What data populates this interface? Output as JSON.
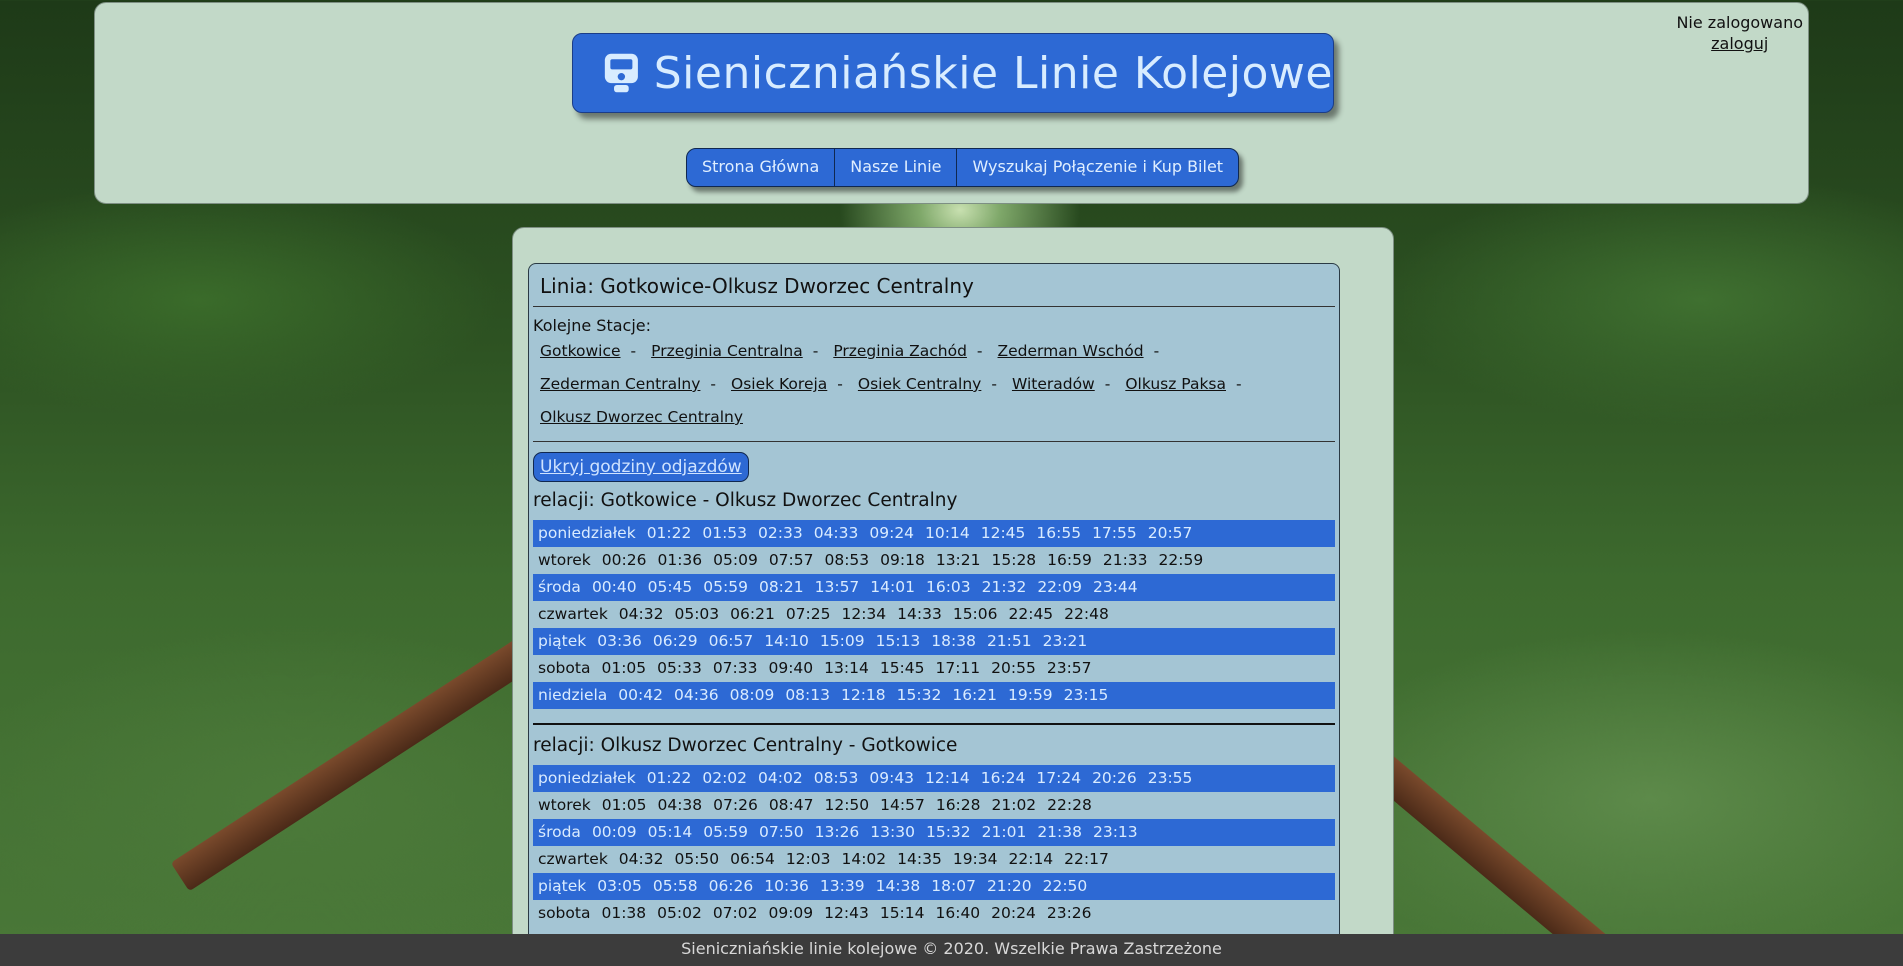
{
  "header": {
    "title": "Sieniczniańskie Linie Kolejowe",
    "logo_icon": "train-icon",
    "login_status": "Nie zalogowano",
    "login_link": "zaloguj",
    "nav": [
      "Strona Główna",
      "Nasze Linie",
      "Wyszukaj Połączenie i Kup Bilet"
    ]
  },
  "line": {
    "title": "Linia: Gotkowice-Olkusz Dworzec Centralny",
    "stations_label": "Kolejne Stacje:",
    "stations": [
      "Gotkowice",
      "Przeginia Centralna",
      "Przeginia Zachód",
      "Zederman Wschód",
      "Zederman Centralny",
      "Osiek Koreja",
      "Osiek Centralny",
      "Witeradów",
      "Olkusz Paksa",
      "Olkusz Dworzec Centralny"
    ],
    "toggle_label": "Ukryj godziny odjazdów",
    "relations": [
      {
        "title": "relacji: Gotkowice - Olkusz Dworzec Centralny",
        "days": [
          {
            "day": "poniedziałek",
            "times": [
              "01:22",
              "01:53",
              "02:33",
              "04:33",
              "09:24",
              "10:14",
              "12:45",
              "16:55",
              "17:55",
              "20:57"
            ]
          },
          {
            "day": "wtorek",
            "times": [
              "00:26",
              "01:36",
              "05:09",
              "07:57",
              "08:53",
              "09:18",
              "13:21",
              "15:28",
              "16:59",
              "21:33",
              "22:59"
            ]
          },
          {
            "day": "środa",
            "times": [
              "00:40",
              "05:45",
              "05:59",
              "08:21",
              "13:57",
              "14:01",
              "16:03",
              "21:32",
              "22:09",
              "23:44"
            ]
          },
          {
            "day": "czwartek",
            "times": [
              "04:32",
              "05:03",
              "06:21",
              "07:25",
              "12:34",
              "14:33",
              "15:06",
              "22:45",
              "22:48"
            ]
          },
          {
            "day": "piątek",
            "times": [
              "03:36",
              "06:29",
              "06:57",
              "14:10",
              "15:09",
              "15:13",
              "18:38",
              "21:51",
              "23:21"
            ]
          },
          {
            "day": "sobota",
            "times": [
              "01:05",
              "05:33",
              "07:33",
              "09:40",
              "13:14",
              "15:45",
              "17:11",
              "20:55",
              "23:57"
            ]
          },
          {
            "day": "niedziela",
            "times": [
              "00:42",
              "04:36",
              "08:09",
              "08:13",
              "12:18",
              "15:32",
              "16:21",
              "19:59",
              "23:15"
            ]
          }
        ]
      },
      {
        "title": "relacji: Olkusz Dworzec Centralny - Gotkowice",
        "days": [
          {
            "day": "poniedziałek",
            "times": [
              "01:22",
              "02:02",
              "04:02",
              "08:53",
              "09:43",
              "12:14",
              "16:24",
              "17:24",
              "20:26",
              "23:55"
            ]
          },
          {
            "day": "wtorek",
            "times": [
              "01:05",
              "04:38",
              "07:26",
              "08:47",
              "12:50",
              "14:57",
              "16:28",
              "21:02",
              "22:28"
            ]
          },
          {
            "day": "środa",
            "times": [
              "00:09",
              "05:14",
              "05:59",
              "07:50",
              "13:26",
              "13:30",
              "15:32",
              "21:01",
              "21:38",
              "23:13"
            ]
          },
          {
            "day": "czwartek",
            "times": [
              "04:32",
              "05:50",
              "06:54",
              "12:03",
              "14:02",
              "14:35",
              "19:34",
              "22:14",
              "22:17"
            ]
          },
          {
            "day": "piątek",
            "times": [
              "03:05",
              "05:58",
              "06:26",
              "10:36",
              "13:39",
              "14:38",
              "18:07",
              "21:20",
              "22:50"
            ]
          },
          {
            "day": "sobota",
            "times": [
              "01:38",
              "05:02",
              "07:02",
              "09:09",
              "12:43",
              "15:14",
              "16:40",
              "20:24",
              "23:26"
            ]
          }
        ]
      }
    ]
  },
  "footer": {
    "text": "Sieniczniańskie linie kolejowe © 2020. Wszelkie Prawa Zastrzeżone"
  },
  "colors": {
    "accent": "#2d69d4",
    "panel": "#c2d9c8",
    "line_box": "#a4c5d4",
    "footer": "#3c3c3c"
  }
}
